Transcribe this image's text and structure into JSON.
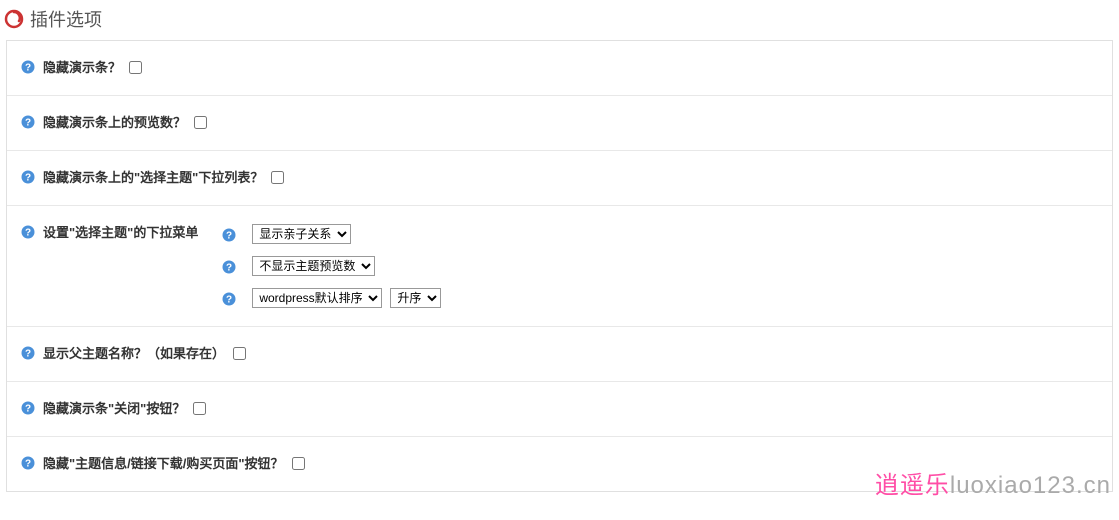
{
  "header": {
    "title": "插件选项"
  },
  "options": {
    "hide_demo_bar": {
      "label": "隐藏演示条？"
    },
    "hide_preview_count": {
      "label": "隐藏演示条上的预览数？"
    },
    "hide_select_theme_dropdown": {
      "label": "隐藏演示条上的\"选择主题\"下拉列表？"
    },
    "set_select_theme_menu": {
      "label": "设置\"选择主题\"的下拉菜单",
      "dropdowns": {
        "relation": "显示亲子关系",
        "preview_count": "不显示主题预览数",
        "sort": "wordpress默认排序",
        "order": "升序"
      }
    },
    "show_parent_theme": {
      "label": "显示父主题名称？（如果存在）"
    },
    "hide_close_button": {
      "label": "隐藏演示条\"关闭\"按钮？"
    },
    "hide_info_button": {
      "label": "隐藏\"主题信息/链接下载/购买页面\"按钮？"
    }
  },
  "watermark": {
    "cn": "逍遥乐",
    "en": "luoxiao123.cn"
  }
}
